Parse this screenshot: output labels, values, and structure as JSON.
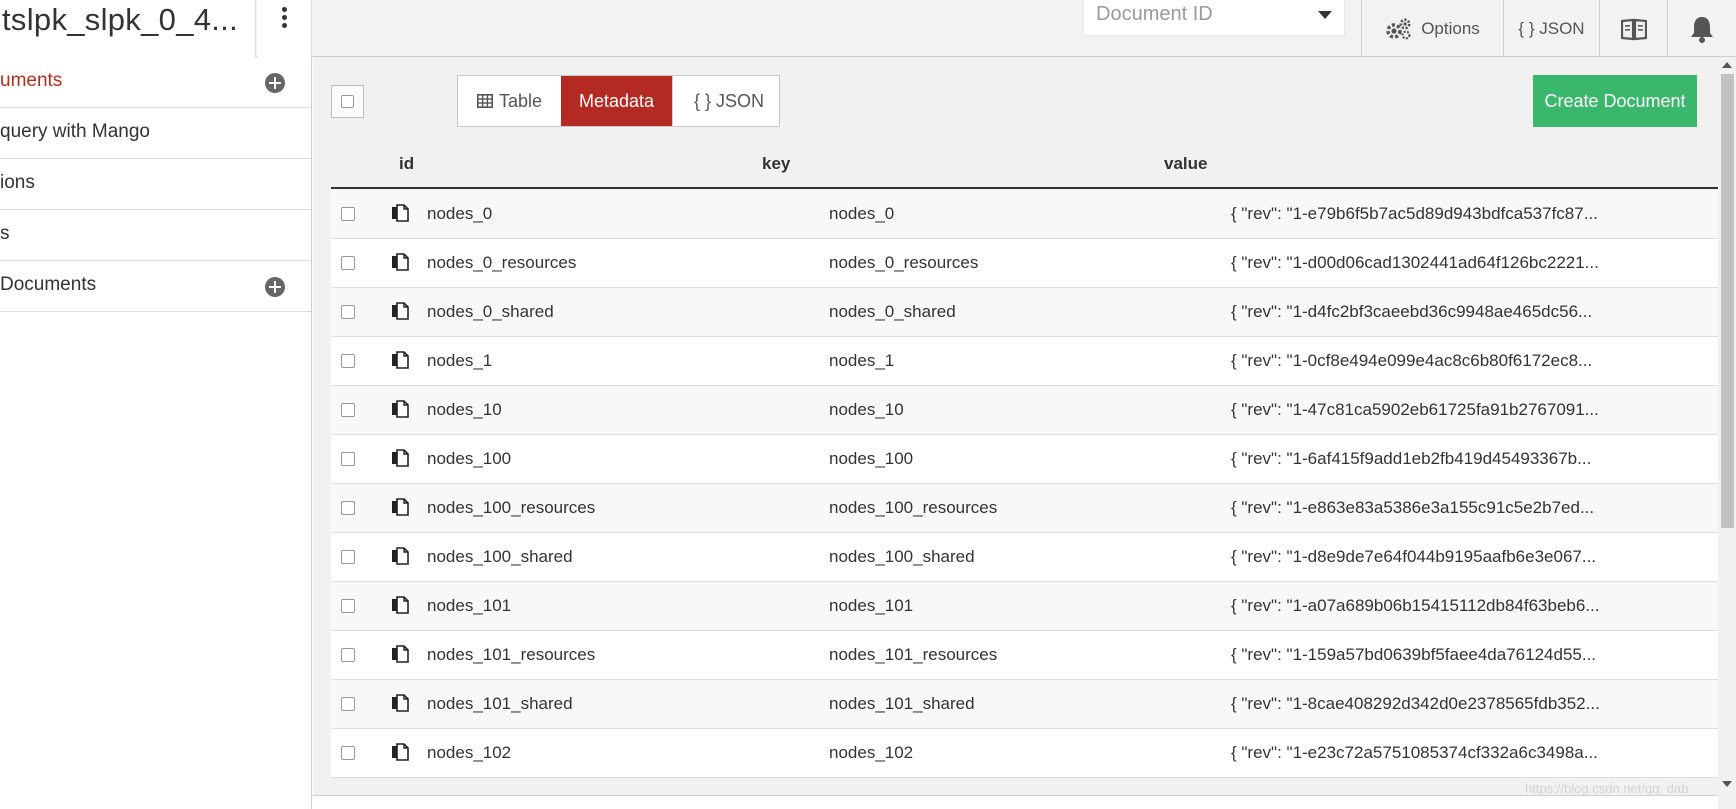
{
  "header": {
    "db_title": "tslpk_slpk_0_4...",
    "document_id_placeholder": "Document ID",
    "options_label": "Options",
    "json_label": "{ } JSON"
  },
  "sidebar": {
    "items": [
      {
        "label": "uments"
      },
      {
        "label": "query with Mango"
      },
      {
        "label": "ions"
      },
      {
        "label": "s"
      },
      {
        "label": "Documents"
      }
    ]
  },
  "toolbar": {
    "view_tabs": [
      "Table",
      "Metadata",
      "{ } JSON"
    ],
    "active_tab": "Metadata",
    "create_label": "Create Document"
  },
  "table": {
    "columns": [
      "id",
      "key",
      "value"
    ],
    "rows": [
      {
        "id": "nodes_0",
        "key": "nodes_0",
        "value": "{ \"rev\": \"1-e79b6f5b7ac5d89d943bdfca537fc87..."
      },
      {
        "id": "nodes_0_resources",
        "key": "nodes_0_resources",
        "value": "{ \"rev\": \"1-d00d06cad1302441ad64f126bc2221..."
      },
      {
        "id": "nodes_0_shared",
        "key": "nodes_0_shared",
        "value": "{ \"rev\": \"1-d4fc2bf3caeebd36c9948ae465dc56..."
      },
      {
        "id": "nodes_1",
        "key": "nodes_1",
        "value": "{ \"rev\": \"1-0cf8e494e099e4ac8c6b80f6172ec8..."
      },
      {
        "id": "nodes_10",
        "key": "nodes_10",
        "value": "{ \"rev\": \"1-47c81ca5902eb61725fa91b2767091..."
      },
      {
        "id": "nodes_100",
        "key": "nodes_100",
        "value": "{ \"rev\": \"1-6af415f9add1eb2fb419d45493367b..."
      },
      {
        "id": "nodes_100_resources",
        "key": "nodes_100_resources",
        "value": "{ \"rev\": \"1-e863e83a5386e3a155c91c5e2b7ed..."
      },
      {
        "id": "nodes_100_shared",
        "key": "nodes_100_shared",
        "value": "{ \"rev\": \"1-d8e9de7e64f044b9195aafb6e3e067..."
      },
      {
        "id": "nodes_101",
        "key": "nodes_101",
        "value": "{ \"rev\": \"1-a07a689b06b15415112db84f63beb6..."
      },
      {
        "id": "nodes_101_resources",
        "key": "nodes_101_resources",
        "value": "{ \"rev\": \"1-159a57bd0639bf5faee4da76124d55..."
      },
      {
        "id": "nodes_101_shared",
        "key": "nodes_101_shared",
        "value": "{ \"rev\": \"1-8cae408292d342d0e2378565fdb352..."
      },
      {
        "id": "nodes_102",
        "key": "nodes_102",
        "value": "{ \"rev\": \"1-e23c72a5751085374cf332a6c3498a..."
      }
    ]
  },
  "watermark": "https://blog.csdn.net/qq_dab",
  "colors": {
    "accent": "#b32a22",
    "create": "#3bb76c"
  }
}
